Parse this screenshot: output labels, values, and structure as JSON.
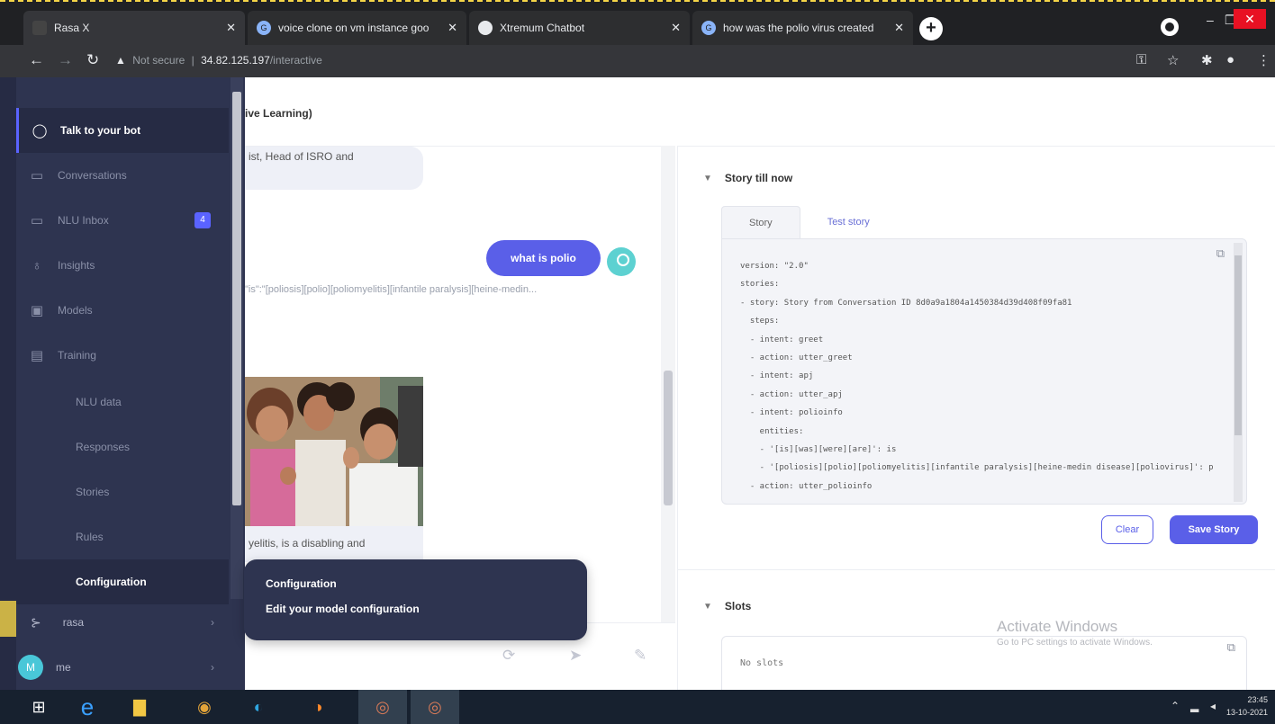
{
  "browser": {
    "tabs": [
      {
        "label": "Rasa X"
      },
      {
        "label": "voice clone on vm instance goo"
      },
      {
        "label": "Xtremum Chatbot"
      },
      {
        "label": "how was the polio virus created"
      }
    ],
    "address": {
      "security": "Not secure",
      "host": "34.82.125.197",
      "path": "/interactive"
    }
  },
  "sidebar": {
    "items": [
      {
        "label": "Talk to your bot",
        "icon": "chat-bubble-icon"
      },
      {
        "label": "Conversations",
        "icon": "conversations-icon"
      },
      {
        "label": "NLU Inbox",
        "icon": "inbox-icon",
        "badge": "4"
      },
      {
        "label": "Insights",
        "icon": "lightbulb-icon"
      },
      {
        "label": "Models",
        "icon": "models-icon"
      },
      {
        "label": "Training",
        "icon": "document-icon"
      }
    ],
    "training_sub": [
      "NLU data",
      "Responses",
      "Stories",
      "Rules",
      "Configuration"
    ],
    "workspace": "rasa",
    "user": {
      "initial": "M",
      "name": "me"
    }
  },
  "chat": {
    "header": "ive Learning)",
    "bot_snippet": "ist, Head of ISRO and",
    "user_message": "what is polio",
    "entity_line": "\"is\":\"[poliosis][polio][poliomyelitis][infantile paralysis][heine-medin...",
    "caption": "yelitis, is a disabling and"
  },
  "tooltip": {
    "title": "Configuration",
    "description": "Edit your model configuration"
  },
  "story": {
    "section_title": "Story till now",
    "tabs": [
      "Story",
      "Test story"
    ],
    "yaml_lines": [
      "version: \"2.0\"",
      "stories:",
      "- story: Story from Conversation ID 8d0a9a1804a1450384d39d408f09fa81",
      "  steps:",
      "  - intent: greet",
      "  - action: utter_greet",
      "  - intent: apj",
      "  - action: utter_apj",
      "  - intent: polioinfo",
      "    entities:",
      "    - '[is][was][were][are]': is",
      "    - '[poliosis][polio][poliomyelitis][infantile paralysis][heine-medin disease][poliovirus]': p",
      "  - action: utter_polioinfo"
    ],
    "clear_label": "Clear",
    "save_label": "Save Story"
  },
  "slots": {
    "section_title": "Slots",
    "empty_text": "No slots"
  },
  "watermark": {
    "line1": "Activate Windows",
    "line2": "Go to PC settings to activate Windows."
  },
  "taskbar": {
    "time": "23:45",
    "date": "13-10-2021"
  }
}
